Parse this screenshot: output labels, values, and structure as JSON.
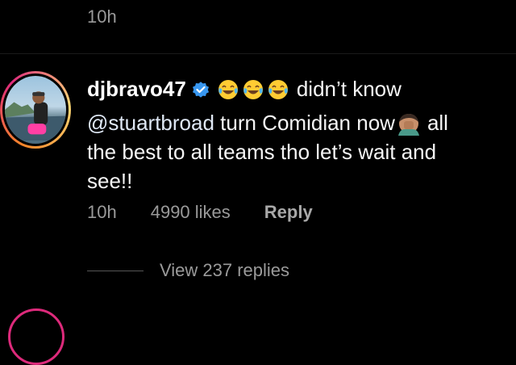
{
  "previous_comment": {
    "time": "10h"
  },
  "comment": {
    "username": "djbravo47",
    "verified": true,
    "text_line1": "didn’t know",
    "mention": "@stuartbroad",
    "text_after_mention": "turn Comidian now",
    "text_after_emoji": "all",
    "text_line3": "the best to all teams tho let’s wait and",
    "text_line4": "see!!",
    "emojis": [
      "face-with-tears-of-joy",
      "face-with-tears-of-joy",
      "face-with-tears-of-joy",
      "person-facepalming"
    ],
    "time": "10h",
    "likes": "4990 likes",
    "reply_label": "Reply",
    "view_replies": "View 237 replies"
  },
  "colors": {
    "background": "#000000",
    "text_primary": "#f5f5f5",
    "text_secondary": "#9a9a9a",
    "verified_badge": "#3897f0",
    "story_ring_start": "#f58529",
    "story_ring_end": "#dd2a7b"
  }
}
